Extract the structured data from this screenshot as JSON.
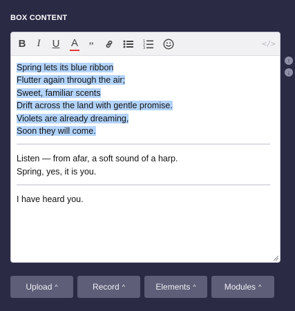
{
  "section": {
    "title": "BOX CONTENT"
  },
  "toolbar": {
    "bold": "B",
    "italic": "I",
    "underline": "U",
    "text_color": "A",
    "quote": "”",
    "code": "</>"
  },
  "content": {
    "selected_lines": [
      "Spring lets its blue ribbon",
      "Flutter again through the air;",
      "Sweet, familiar scents",
      "Drift across the land with gentle promise.",
      "Violets are already dreaming,",
      "Soon they will come."
    ],
    "paragraph_2": [
      "Listen — from afar, a soft sound of a harp.",
      "Spring, yes, it is you."
    ],
    "paragraph_3": [
      "I have heard you."
    ]
  },
  "side_controls": {
    "up": "↑",
    "down": "↓"
  },
  "bottom": {
    "upload": "Upload",
    "record": "Record",
    "elements": "Elements",
    "modules": "Modules",
    "chevron": "^"
  },
  "colors": {
    "background": "#2b2a45",
    "selection": "#b3d4fc",
    "button": "#5e5e78",
    "text_color_bar": "#e53935"
  },
  "icons": [
    "bold-icon",
    "italic-icon",
    "underline-icon",
    "text-color-icon",
    "quote-icon",
    "link-icon",
    "bullet-list-icon",
    "numbered-list-icon",
    "emoji-icon",
    "code-icon",
    "arrow-up-icon",
    "arrow-down-icon",
    "chevron-up-icon"
  ]
}
